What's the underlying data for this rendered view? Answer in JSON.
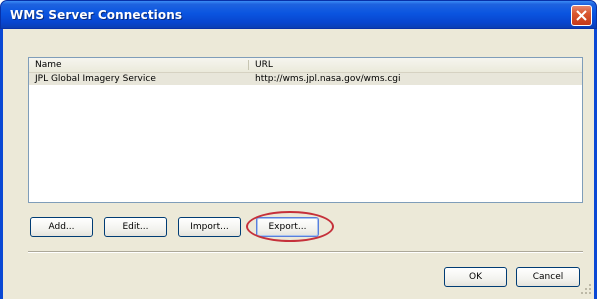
{
  "window": {
    "title": "WMS Server Connections"
  },
  "table": {
    "columns": [
      "Name",
      "URL"
    ],
    "rows": [
      {
        "name": "JPL Global Imagery Service",
        "url": "http://wms.jpl.nasa.gov/wms.cgi"
      }
    ]
  },
  "actions": {
    "add": "Add...",
    "edit": "Edit...",
    "import": "Import...",
    "export": "Export..."
  },
  "footer": {
    "ok": "OK",
    "cancel": "Cancel"
  },
  "colors": {
    "titlebar": "#0a55e0",
    "dialog_bg": "#ece9d8",
    "highlight": "#c5303a",
    "row_selected": "#e8e6da"
  }
}
